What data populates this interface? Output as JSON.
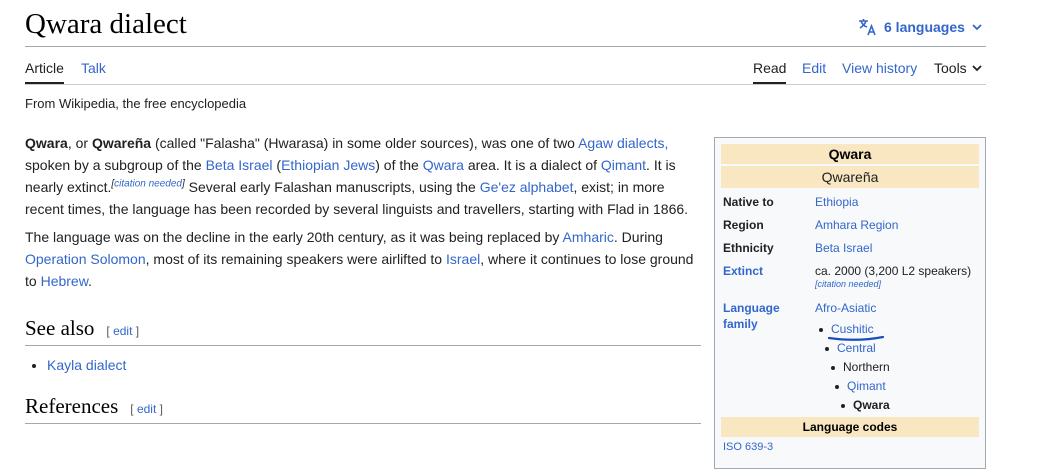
{
  "page": {
    "title": "Qwara dialect",
    "languages_label": "6 languages",
    "tagline": "From Wikipedia, the free encyclopedia"
  },
  "tabs": {
    "left": [
      {
        "label": "Article",
        "selected": true
      },
      {
        "label": "Talk",
        "selected": false
      }
    ],
    "right": [
      {
        "label": "Read",
        "selected": true
      },
      {
        "label": "Edit",
        "selected": false
      },
      {
        "label": "View history",
        "selected": false
      }
    ],
    "tools_label": "Tools"
  },
  "body": {
    "p1": {
      "b1": "Qwara",
      "t1": ", or ",
      "b2": "Qwareña",
      "t2": " (called \"Falasha\" (Hwarasa) in some older sources), was one of two ",
      "l1": "Agaw dialects,",
      "t3": " spoken by a subgroup of the ",
      "l2": "Beta Israel",
      "t4": " (",
      "l3": "Ethiopian Jews",
      "t5": ") of the ",
      "l4": "Qwara",
      "t6": " area. It is a dialect of ",
      "l5": "Qimant",
      "t7": ". It is nearly extinct.",
      "sup_open": "[",
      "sup_link": "citation needed",
      "sup_close": "]",
      "t8": " Several early Falashan manuscripts, using the ",
      "l6": "Ge'ez alphabet",
      "t9": ", exist; in more recent times, the language has been recorded by several linguists and travellers, starting with Flad in 1866."
    },
    "p2": {
      "t1": "The language was on the decline in the early 20th century, as it was being replaced by ",
      "l1": "Amharic",
      "t2": ". During ",
      "l2": "Operation Solomon",
      "t3": ", most of its remaining speakers were airlifted to ",
      "l3": "Israel",
      "t4": ", where it continues to lose ground to ",
      "l4": "Hebrew",
      "t5": "."
    }
  },
  "sections": {
    "see_also": {
      "heading": "See also",
      "edit_open": "[ ",
      "edit_label": "edit",
      "edit_close": " ]",
      "items": [
        "Kayla dialect"
      ]
    },
    "references": {
      "heading": "References",
      "edit_open": "[ ",
      "edit_label": "edit",
      "edit_close": " ]"
    }
  },
  "infobox": {
    "name": "Qwara",
    "native_name": "Qwareña",
    "rows": {
      "native_to": {
        "label": "Native to",
        "value": "Ethiopia"
      },
      "region": {
        "label": "Region",
        "value": "Amhara Region"
      },
      "ethnicity": {
        "label": "Ethnicity",
        "value": "Beta Israel"
      },
      "extinct": {
        "label": "Extinct",
        "value": "ca. 2000 (3,200 L2 speakers)",
        "note": "[citation needed]"
      },
      "family": {
        "label": "Language family",
        "root": "Afro-Asiatic"
      }
    },
    "family_tree": [
      "Cushitic",
      "Central",
      "Northern",
      "Qimant",
      "Qwara"
    ],
    "codes_header": "Language codes",
    "cut_text": "ISO 639-3"
  },
  "colors": {
    "link": "#3366cc",
    "infobox_header": "#f9e7c1",
    "annotation_underline": "#1a4fb8"
  }
}
